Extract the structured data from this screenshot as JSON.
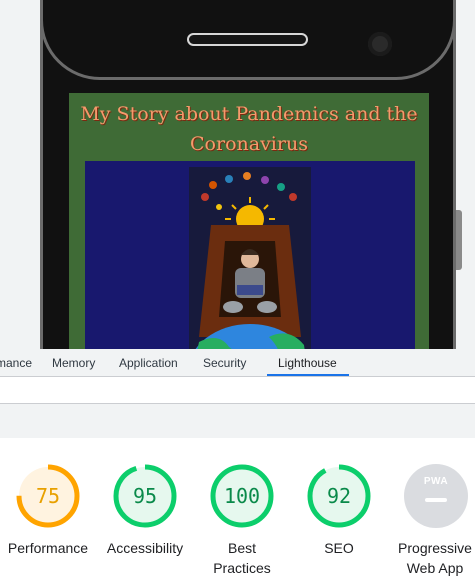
{
  "preview": {
    "site_title": "My Story about Pandemics and the Coronavirus"
  },
  "devtools": {
    "tabs": [
      {
        "label": "mance",
        "active": false
      },
      {
        "label": "Memory",
        "active": false
      },
      {
        "label": "Application",
        "active": false
      },
      {
        "label": "Security",
        "active": false
      },
      {
        "label": "Lighthouse",
        "active": true
      }
    ]
  },
  "lighthouse": {
    "categories": [
      {
        "label": "Performance",
        "score": "75",
        "fraction": 0.75,
        "color": "#ffa400",
        "fill": "#fff3e0"
      },
      {
        "label": "Accessibility",
        "score": "95",
        "fraction": 0.95,
        "color": "#0cce6b",
        "fill": "#e6f8ee"
      },
      {
        "label": "Best Practices",
        "score": "100",
        "fraction": 1.0,
        "color": "#0cce6b",
        "fill": "#e6f8ee"
      },
      {
        "label": "SEO",
        "score": "92",
        "fraction": 0.92,
        "color": "#0cce6b",
        "fill": "#e6f8ee"
      }
    ],
    "pwa": {
      "label": "Progressive Web App",
      "badge_text": "PWA"
    }
  },
  "colors": {
    "accent": "#1a73e8",
    "score_average": "#ffa400",
    "score_pass": "#0cce6b"
  }
}
